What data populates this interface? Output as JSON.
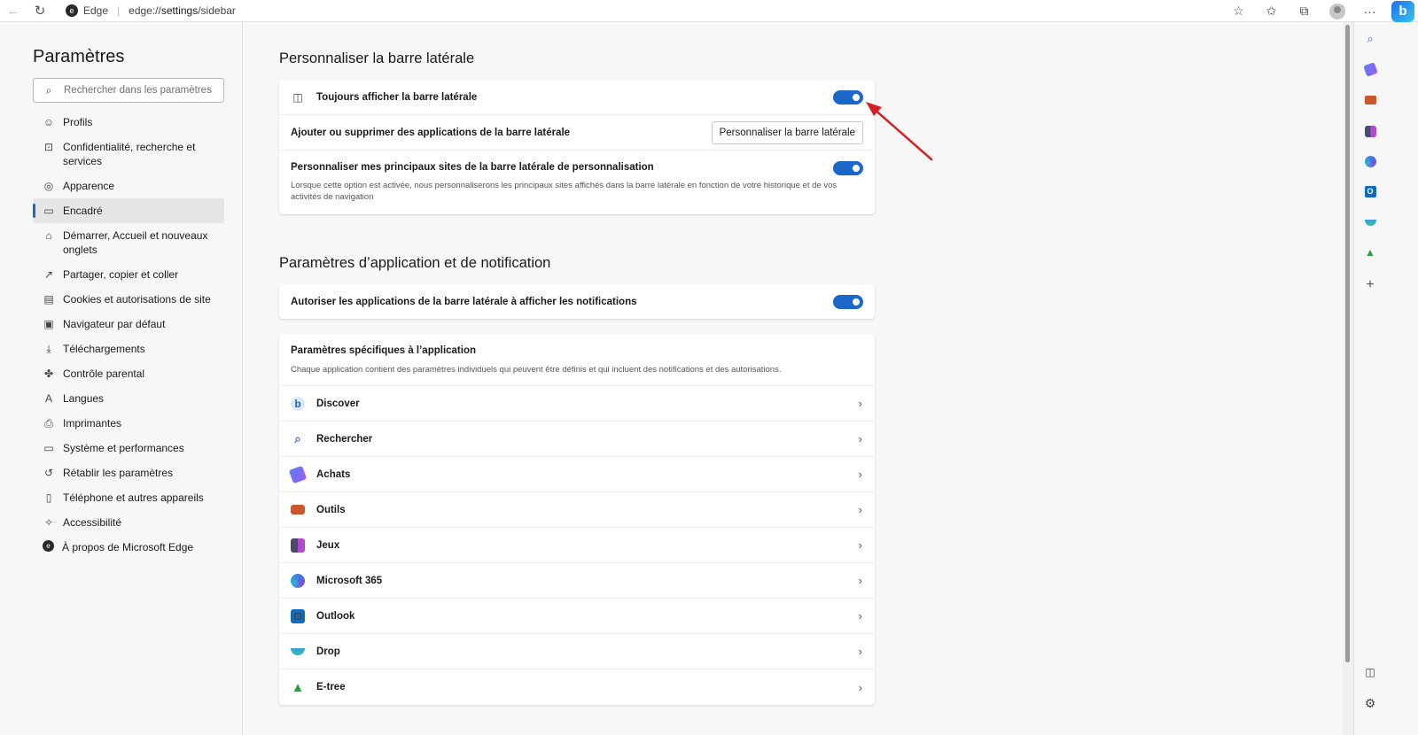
{
  "browser": {
    "site_name": "Edge",
    "url_prefix": "edge://",
    "url_path": "settings",
    "url_suffix": "/sidebar"
  },
  "leftnav": {
    "title": "Paramètres",
    "search_placeholder": "Rechercher dans les paramètres",
    "items": [
      {
        "label": "Profils",
        "icon": "profile-icon"
      },
      {
        "label": "Confidentialité, recherche et services",
        "icon": "lock-icon"
      },
      {
        "label": "Apparence",
        "icon": "appearance-icon"
      },
      {
        "label": "Encadré",
        "icon": "sidebar-icon",
        "active": true
      },
      {
        "label": "Démarrer, Accueil et nouveaux onglets",
        "icon": "home-icon"
      },
      {
        "label": "Partager, copier et coller",
        "icon": "share-icon"
      },
      {
        "label": "Cookies et autorisations de site",
        "icon": "cookies-icon"
      },
      {
        "label": "Navigateur par défaut",
        "icon": "browser-icon"
      },
      {
        "label": "Téléchargements",
        "icon": "download-icon"
      },
      {
        "label": "Contrôle parental",
        "icon": "family-icon"
      },
      {
        "label": "Langues",
        "icon": "language-icon"
      },
      {
        "label": "Imprimantes",
        "icon": "printer-icon"
      },
      {
        "label": "Système et performances",
        "icon": "laptop-icon"
      },
      {
        "label": "Rétablir les paramètres",
        "icon": "reset-icon"
      },
      {
        "label": "Téléphone et autres appareils",
        "icon": "phone-icon"
      },
      {
        "label": "Accessibilité",
        "icon": "accessibility-icon"
      },
      {
        "label": "À propos de Microsoft Edge",
        "icon": "edge-icon"
      }
    ]
  },
  "sidebar_section": {
    "title": "Personnaliser la barre latérale",
    "always_show_label": "Toujours afficher la barre latérale",
    "always_show_on": true,
    "add_remove_label": "Ajouter ou supprimer des applications de la barre latérale",
    "customize_button": "Personnaliser la barre latérale",
    "personalize_label": "Personnaliser mes principaux sites de la barre latérale de personnalisation",
    "personalize_on": true,
    "personalize_desc": "Lorsque cette option est activée, nous personnaliserons les principaux sites affichés dans la barre latérale en fonction de votre historique et de vos activités de navigation"
  },
  "notif_section": {
    "title": "Paramètres d’application et de notification",
    "allow_notif_label": "Autoriser les applications de la barre latérale à afficher les notifications",
    "allow_notif_on": true,
    "app_specific_title": "Paramètres spécifiques à l’application",
    "app_specific_desc": "Chaque application contient des paramètres individuels qui peuvent être définis et qui incluent des notifications et des autorisations.",
    "apps": [
      {
        "label": "Discover",
        "icon": "discover-icon"
      },
      {
        "label": "Rechercher",
        "icon": "search-icon"
      },
      {
        "label": "Achats",
        "icon": "shopping-tag-icon"
      },
      {
        "label": "Outils",
        "icon": "toolbox-icon"
      },
      {
        "label": "Jeux",
        "icon": "games-icon"
      },
      {
        "label": "Microsoft 365",
        "icon": "office-icon"
      },
      {
        "label": "Outlook",
        "icon": "outlook-icon"
      },
      {
        "label": "Drop",
        "icon": "drop-icon"
      },
      {
        "label": "E-tree",
        "icon": "tree-icon"
      }
    ]
  },
  "colors": {
    "accent": "#1a66c9",
    "annotation_arrow": "#d42020"
  }
}
